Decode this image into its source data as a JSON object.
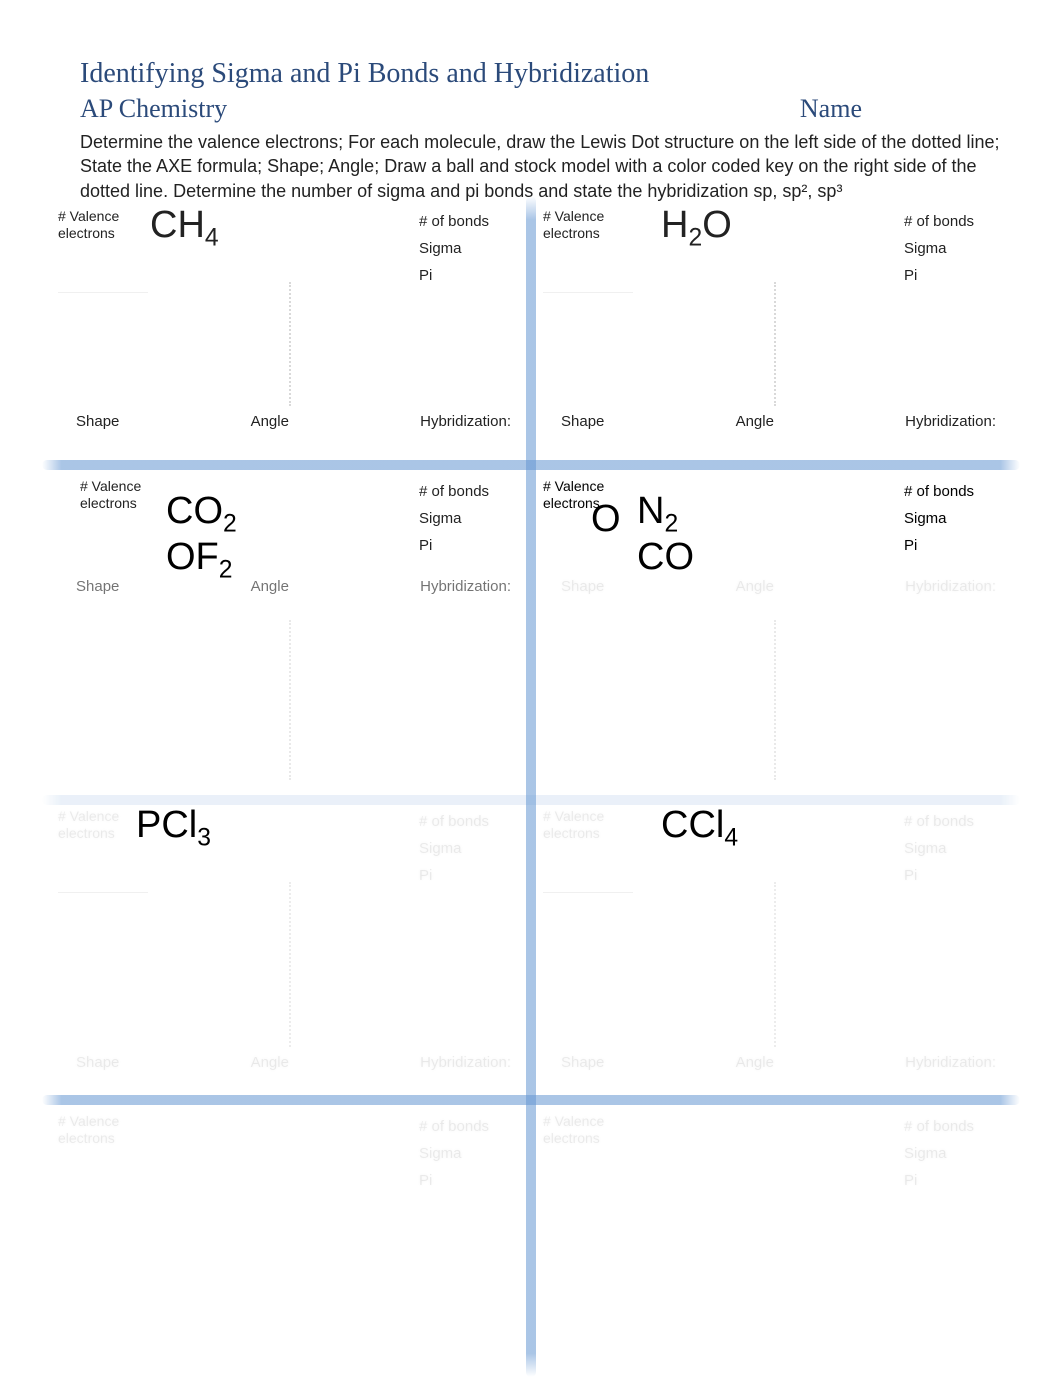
{
  "header": {
    "title": "Identifying Sigma and Pi Bonds and Hybridization",
    "course": "AP Chemistry",
    "name_label": "Name",
    "instructions": "Determine the valence electrons; For each molecule, draw the Lewis Dot structure on the left side of the dotted line; State the AXE formula; Shape; Angle; Draw a ball and stock model with a color coded key on the right side of the dotted line.  Determine the number of sigma and pi bonds and state the hybridization sp, sp², sp³"
  },
  "labels": {
    "valence_line1": "# Valence",
    "valence_line2": "electrons",
    "bonds_line1": "# of bonds",
    "bonds_line2": "Sigma",
    "bonds_line3": "Pi",
    "shape": "Shape",
    "angle": "Angle",
    "hybridization": "Hybridization:"
  },
  "molecules": {
    "r1c1": {
      "base": "CH",
      "sub": "4"
    },
    "r1c2": {
      "base": "H",
      "sub": "2",
      "trail": "O"
    },
    "r2c1_a": {
      "base": "CO",
      "sub": "2"
    },
    "r2c1_b": {
      "base": "OF",
      "sub": "2"
    },
    "r2c2_a": {
      "base": "N",
      "sub": "2"
    },
    "r2c2_b": {
      "base": "CO",
      "sub": ""
    },
    "r2c2_o": "O",
    "r3c1": {
      "base": "PCl",
      "sub": "3"
    },
    "r3c2": {
      "base": "CCl",
      "sub": "4"
    }
  }
}
